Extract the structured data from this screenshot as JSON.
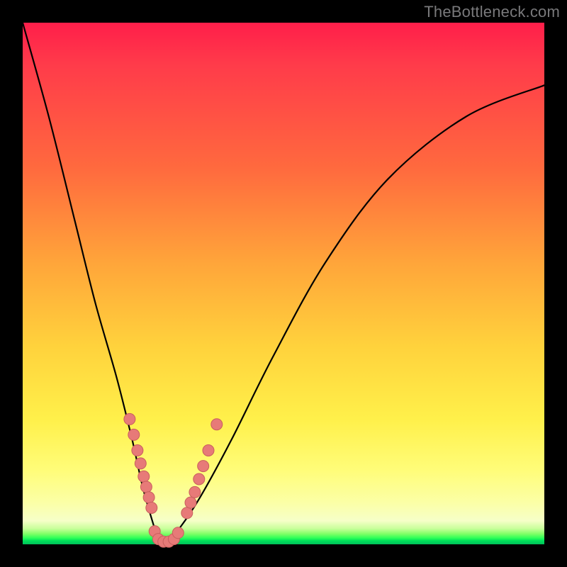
{
  "watermark": "TheBottleneck.com",
  "colors": {
    "frame": "#000000",
    "curve": "#000000",
    "bead_fill": "#e77a78",
    "bead_stroke": "#c85f5d",
    "gradient_stops": [
      "#ff1e4a",
      "#ff6a3e",
      "#ffd23c",
      "#fffd7a",
      "#00e05a"
    ]
  },
  "chart_data": {
    "type": "line",
    "title": "",
    "xlabel": "",
    "ylabel": "",
    "xlim": [
      0,
      100
    ],
    "ylim": [
      0,
      100
    ],
    "series": [
      {
        "name": "bottleneck-curve",
        "x": [
          0,
          5,
          10,
          14,
          18,
          21,
          23,
          25,
          26,
          27,
          28,
          30,
          34,
          40,
          48,
          58,
          70,
          85,
          100
        ],
        "y": [
          100,
          82,
          62,
          46,
          32,
          20,
          11,
          4,
          1,
          0,
          1,
          3,
          9,
          20,
          36,
          54,
          70,
          82,
          88
        ]
      }
    ],
    "markers": [
      {
        "name": "left-cluster",
        "points": [
          {
            "x": 20.5,
            "y": 24
          },
          {
            "x": 21.3,
            "y": 21
          },
          {
            "x": 22.0,
            "y": 18
          },
          {
            "x": 22.6,
            "y": 15.5
          },
          {
            "x": 23.2,
            "y": 13
          },
          {
            "x": 23.7,
            "y": 11
          },
          {
            "x": 24.2,
            "y": 9
          },
          {
            "x": 24.7,
            "y": 7
          }
        ]
      },
      {
        "name": "bottom-cluster",
        "points": [
          {
            "x": 25.3,
            "y": 2.5
          },
          {
            "x": 26.0,
            "y": 1
          },
          {
            "x": 27.0,
            "y": 0.5
          },
          {
            "x": 28.0,
            "y": 0.5
          },
          {
            "x": 29.0,
            "y": 1
          },
          {
            "x": 29.8,
            "y": 2.2
          }
        ]
      },
      {
        "name": "right-cluster",
        "points": [
          {
            "x": 31.5,
            "y": 6
          },
          {
            "x": 32.2,
            "y": 8
          },
          {
            "x": 33.0,
            "y": 10
          },
          {
            "x": 33.8,
            "y": 12.5
          },
          {
            "x": 34.6,
            "y": 15
          },
          {
            "x": 35.6,
            "y": 18
          },
          {
            "x": 37.2,
            "y": 23
          }
        ]
      }
    ]
  }
}
